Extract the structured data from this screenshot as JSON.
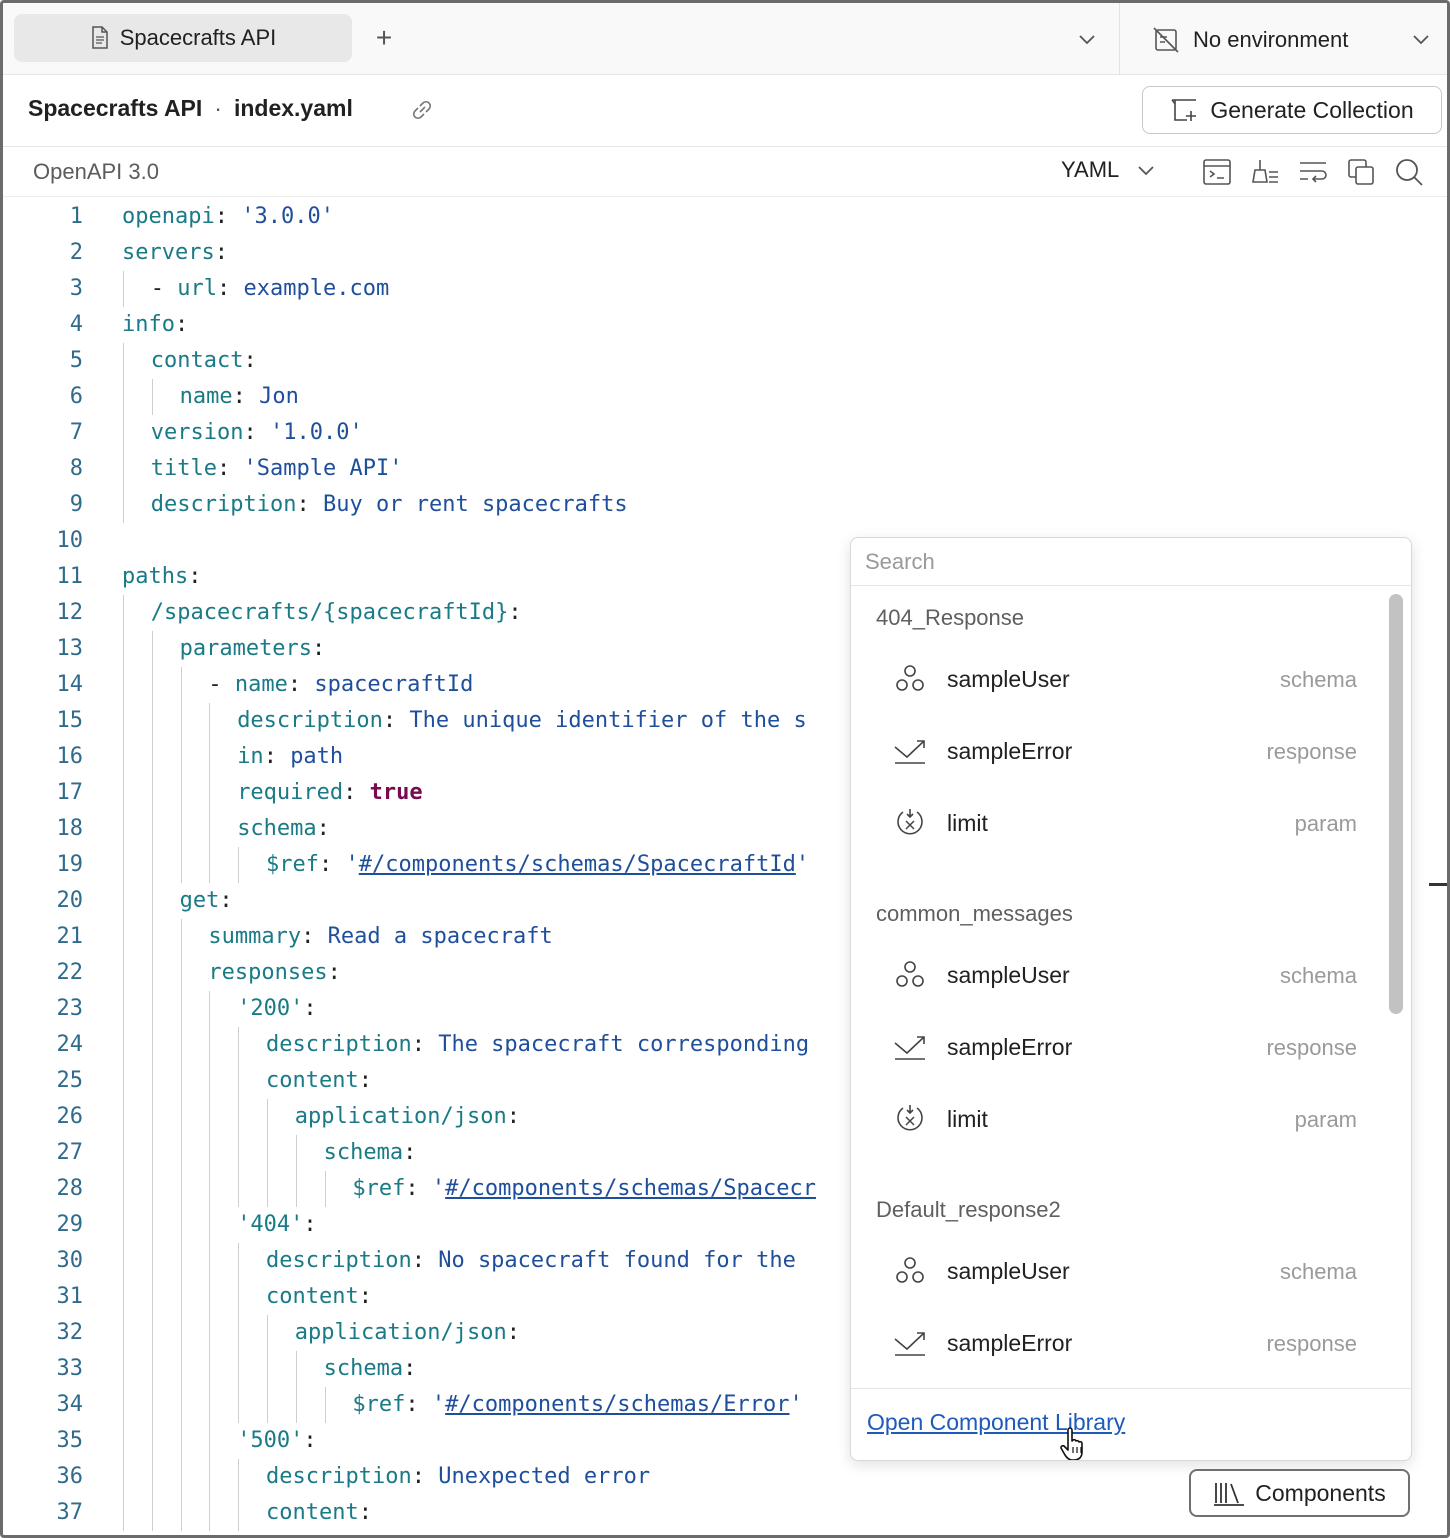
{
  "tabs": {
    "active_label": "Spacecrafts API",
    "add_label": "+"
  },
  "environment": {
    "label": "No environment"
  },
  "title_row": {
    "collection": "Spacecrafts API",
    "separator": "·",
    "file": "index.yaml",
    "generate_label": "Generate Collection"
  },
  "toolbar": {
    "spec_version": "OpenAPI 3.0",
    "format": "YAML",
    "icons": [
      "terminal-icon",
      "beautify-icon",
      "wrap-icon",
      "copy-icon",
      "search-icon"
    ]
  },
  "editor": {
    "lines": [
      {
        "n": "1",
        "indent": 0,
        "parts": [
          [
            "k",
            "openapi"
          ],
          [
            "p",
            ": "
          ],
          [
            "v",
            "'3.0.0'"
          ]
        ]
      },
      {
        "n": "2",
        "indent": 0,
        "parts": [
          [
            "k",
            "servers"
          ],
          [
            "p",
            ":"
          ]
        ]
      },
      {
        "n": "3",
        "indent": 1,
        "parts": [
          [
            "p",
            "- "
          ],
          [
            "k",
            "url"
          ],
          [
            "p",
            ": "
          ],
          [
            "v",
            "example.com"
          ]
        ]
      },
      {
        "n": "4",
        "indent": 0,
        "parts": [
          [
            "k",
            "info"
          ],
          [
            "p",
            ":"
          ]
        ]
      },
      {
        "n": "5",
        "indent": 1,
        "parts": [
          [
            "k",
            "contact"
          ],
          [
            "p",
            ":"
          ]
        ]
      },
      {
        "n": "6",
        "indent": 2,
        "parts": [
          [
            "k",
            "name"
          ],
          [
            "p",
            ": "
          ],
          [
            "v",
            "Jon"
          ]
        ]
      },
      {
        "n": "7",
        "indent": 1,
        "parts": [
          [
            "k",
            "version"
          ],
          [
            "p",
            ": "
          ],
          [
            "v",
            "'1.0.0'"
          ]
        ]
      },
      {
        "n": "8",
        "indent": 1,
        "parts": [
          [
            "k",
            "title"
          ],
          [
            "p",
            ": "
          ],
          [
            "v",
            "'Sample API'"
          ]
        ]
      },
      {
        "n": "9",
        "indent": 1,
        "parts": [
          [
            "k",
            "description"
          ],
          [
            "p",
            ": "
          ],
          [
            "v",
            "Buy or rent spacecrafts"
          ]
        ]
      },
      {
        "n": "10",
        "indent": 0,
        "parts": []
      },
      {
        "n": "11",
        "indent": 0,
        "parts": [
          [
            "k",
            "paths"
          ],
          [
            "p",
            ":"
          ]
        ]
      },
      {
        "n": "12",
        "indent": 1,
        "parts": [
          [
            "k",
            "/spacecrafts/{spacecraftId}"
          ],
          [
            "p",
            ":"
          ]
        ]
      },
      {
        "n": "13",
        "indent": 2,
        "parts": [
          [
            "k",
            "parameters"
          ],
          [
            "p",
            ":"
          ]
        ]
      },
      {
        "n": "14",
        "indent": 3,
        "parts": [
          [
            "p",
            "- "
          ],
          [
            "k",
            "name"
          ],
          [
            "p",
            ": "
          ],
          [
            "v",
            "spacecraftId"
          ]
        ]
      },
      {
        "n": "15",
        "indent": 4,
        "parts": [
          [
            "k",
            "description"
          ],
          [
            "p",
            ": "
          ],
          [
            "v",
            "The unique identifier of the s"
          ]
        ]
      },
      {
        "n": "16",
        "indent": 4,
        "parts": [
          [
            "k",
            "in"
          ],
          [
            "p",
            ": "
          ],
          [
            "v",
            "path"
          ]
        ]
      },
      {
        "n": "17",
        "indent": 4,
        "parts": [
          [
            "k",
            "required"
          ],
          [
            "p",
            ": "
          ],
          [
            "b",
            "true"
          ]
        ]
      },
      {
        "n": "18",
        "indent": 4,
        "parts": [
          [
            "k",
            "schema"
          ],
          [
            "p",
            ":"
          ]
        ]
      },
      {
        "n": "19",
        "indent": 5,
        "parts": [
          [
            "k",
            "$ref"
          ],
          [
            "p",
            ": "
          ],
          [
            "v",
            "'"
          ],
          [
            "r",
            "#/components/schemas/SpacecraftId"
          ],
          [
            "v",
            "'"
          ]
        ]
      },
      {
        "n": "20",
        "indent": 2,
        "parts": [
          [
            "k",
            "get"
          ],
          [
            "p",
            ":"
          ]
        ]
      },
      {
        "n": "21",
        "indent": 3,
        "parts": [
          [
            "k",
            "summary"
          ],
          [
            "p",
            ": "
          ],
          [
            "v",
            "Read a spacecraft"
          ]
        ]
      },
      {
        "n": "22",
        "indent": 3,
        "parts": [
          [
            "k",
            "responses"
          ],
          [
            "p",
            ":"
          ]
        ]
      },
      {
        "n": "23",
        "indent": 4,
        "parts": [
          [
            "k",
            "'200'"
          ],
          [
            "p",
            ":"
          ]
        ]
      },
      {
        "n": "24",
        "indent": 5,
        "parts": [
          [
            "k",
            "description"
          ],
          [
            "p",
            ": "
          ],
          [
            "v",
            "The spacecraft corresponding"
          ]
        ]
      },
      {
        "n": "25",
        "indent": 5,
        "parts": [
          [
            "k",
            "content"
          ],
          [
            "p",
            ":"
          ]
        ]
      },
      {
        "n": "26",
        "indent": 6,
        "parts": [
          [
            "k",
            "application/json"
          ],
          [
            "p",
            ":"
          ]
        ]
      },
      {
        "n": "27",
        "indent": 7,
        "parts": [
          [
            "k",
            "schema"
          ],
          [
            "p",
            ":"
          ]
        ]
      },
      {
        "n": "28",
        "indent": 8,
        "parts": [
          [
            "k",
            "$ref"
          ],
          [
            "p",
            ": "
          ],
          [
            "v",
            "'"
          ],
          [
            "r",
            "#/components/schemas/Spacecr"
          ]
        ]
      },
      {
        "n": "29",
        "indent": 4,
        "parts": [
          [
            "k",
            "'404'"
          ],
          [
            "p",
            ":"
          ]
        ]
      },
      {
        "n": "30",
        "indent": 5,
        "parts": [
          [
            "k",
            "description"
          ],
          [
            "p",
            ": "
          ],
          [
            "v",
            "No spacecraft found for the"
          ]
        ]
      },
      {
        "n": "31",
        "indent": 5,
        "parts": [
          [
            "k",
            "content"
          ],
          [
            "p",
            ":"
          ]
        ]
      },
      {
        "n": "32",
        "indent": 6,
        "parts": [
          [
            "k",
            "application/json"
          ],
          [
            "p",
            ":"
          ]
        ]
      },
      {
        "n": "33",
        "indent": 7,
        "parts": [
          [
            "k",
            "schema"
          ],
          [
            "p",
            ":"
          ]
        ]
      },
      {
        "n": "34",
        "indent": 8,
        "parts": [
          [
            "k",
            "$ref"
          ],
          [
            "p",
            ": "
          ],
          [
            "v",
            "'"
          ],
          [
            "r",
            "#/components/schemas/Error"
          ],
          [
            "v",
            "'"
          ]
        ]
      },
      {
        "n": "35",
        "indent": 4,
        "parts": [
          [
            "k",
            "'500'"
          ],
          [
            "p",
            ":"
          ]
        ]
      },
      {
        "n": "36",
        "indent": 5,
        "parts": [
          [
            "k",
            "description"
          ],
          [
            "p",
            ": "
          ],
          [
            "v",
            "Unexpected error"
          ]
        ]
      },
      {
        "n": "37",
        "indent": 5,
        "parts": [
          [
            "k",
            "content"
          ],
          [
            "p",
            ":"
          ]
        ]
      }
    ]
  },
  "component_popup": {
    "search_placeholder": "Search",
    "groups": [
      {
        "name": "404_Response",
        "items": [
          {
            "name": "sampleUser",
            "type": "schema",
            "icon": "schema-icon"
          },
          {
            "name": "sampleError",
            "type": "response",
            "icon": "response-icon"
          },
          {
            "name": "limit",
            "type": "param",
            "icon": "param-icon"
          }
        ]
      },
      {
        "name": "common_messages",
        "items": [
          {
            "name": "sampleUser",
            "type": "schema",
            "icon": "schema-icon"
          },
          {
            "name": "sampleError",
            "type": "response",
            "icon": "response-icon"
          },
          {
            "name": "limit",
            "type": "param",
            "icon": "param-icon"
          }
        ]
      },
      {
        "name": "Default_response2",
        "items": [
          {
            "name": "sampleUser",
            "type": "schema",
            "icon": "schema-icon"
          },
          {
            "name": "sampleError",
            "type": "response",
            "icon": "response-icon"
          }
        ]
      }
    ],
    "footer_link": "Open Component Library"
  },
  "components_button": {
    "label": "Components"
  },
  "colors": {
    "key": "#1a7a86",
    "value": "#1f4f9c",
    "boolean": "#7a0a50",
    "link": "#1d5ab9"
  }
}
